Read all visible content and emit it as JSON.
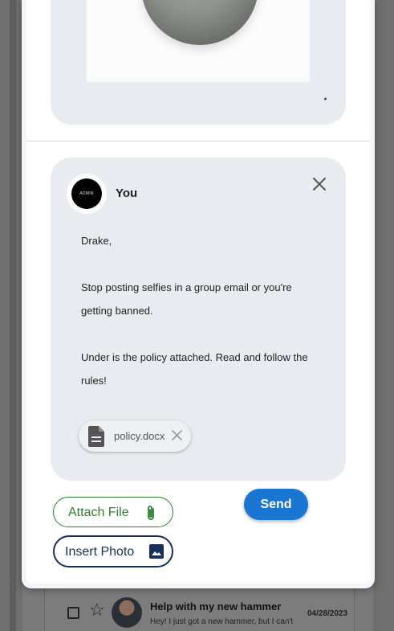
{
  "background_list": {
    "subject": "Help with my new hammer",
    "snippet": "Hey! I just got a new hammer, but I can't",
    "date": "04/28/2023"
  },
  "compose": {
    "from_name": "You",
    "avatar_text": "ADMIN",
    "body": {
      "greeting": "Drake,",
      "line1": "Stop posting selfies in a group email or you're",
      "line2": "getting banned.",
      "line3": "Under is the policy attached.  Read and follow the",
      "line4": "rules!"
    },
    "attachment": {
      "filename": "policy.docx"
    }
  },
  "actions": {
    "attach_file_label": "Attach File",
    "insert_photo_label": "Insert Photo",
    "send_label": "Send"
  },
  "icons": {
    "close": "close-icon",
    "document": "document-icon",
    "attachment": "paperclip-icon",
    "photo": "image-icon",
    "star": "star-icon"
  },
  "colors": {
    "send": "#1976d2",
    "attach": "#2e7d32",
    "photo": "#16305a",
    "bubble": "#e8ebef"
  }
}
